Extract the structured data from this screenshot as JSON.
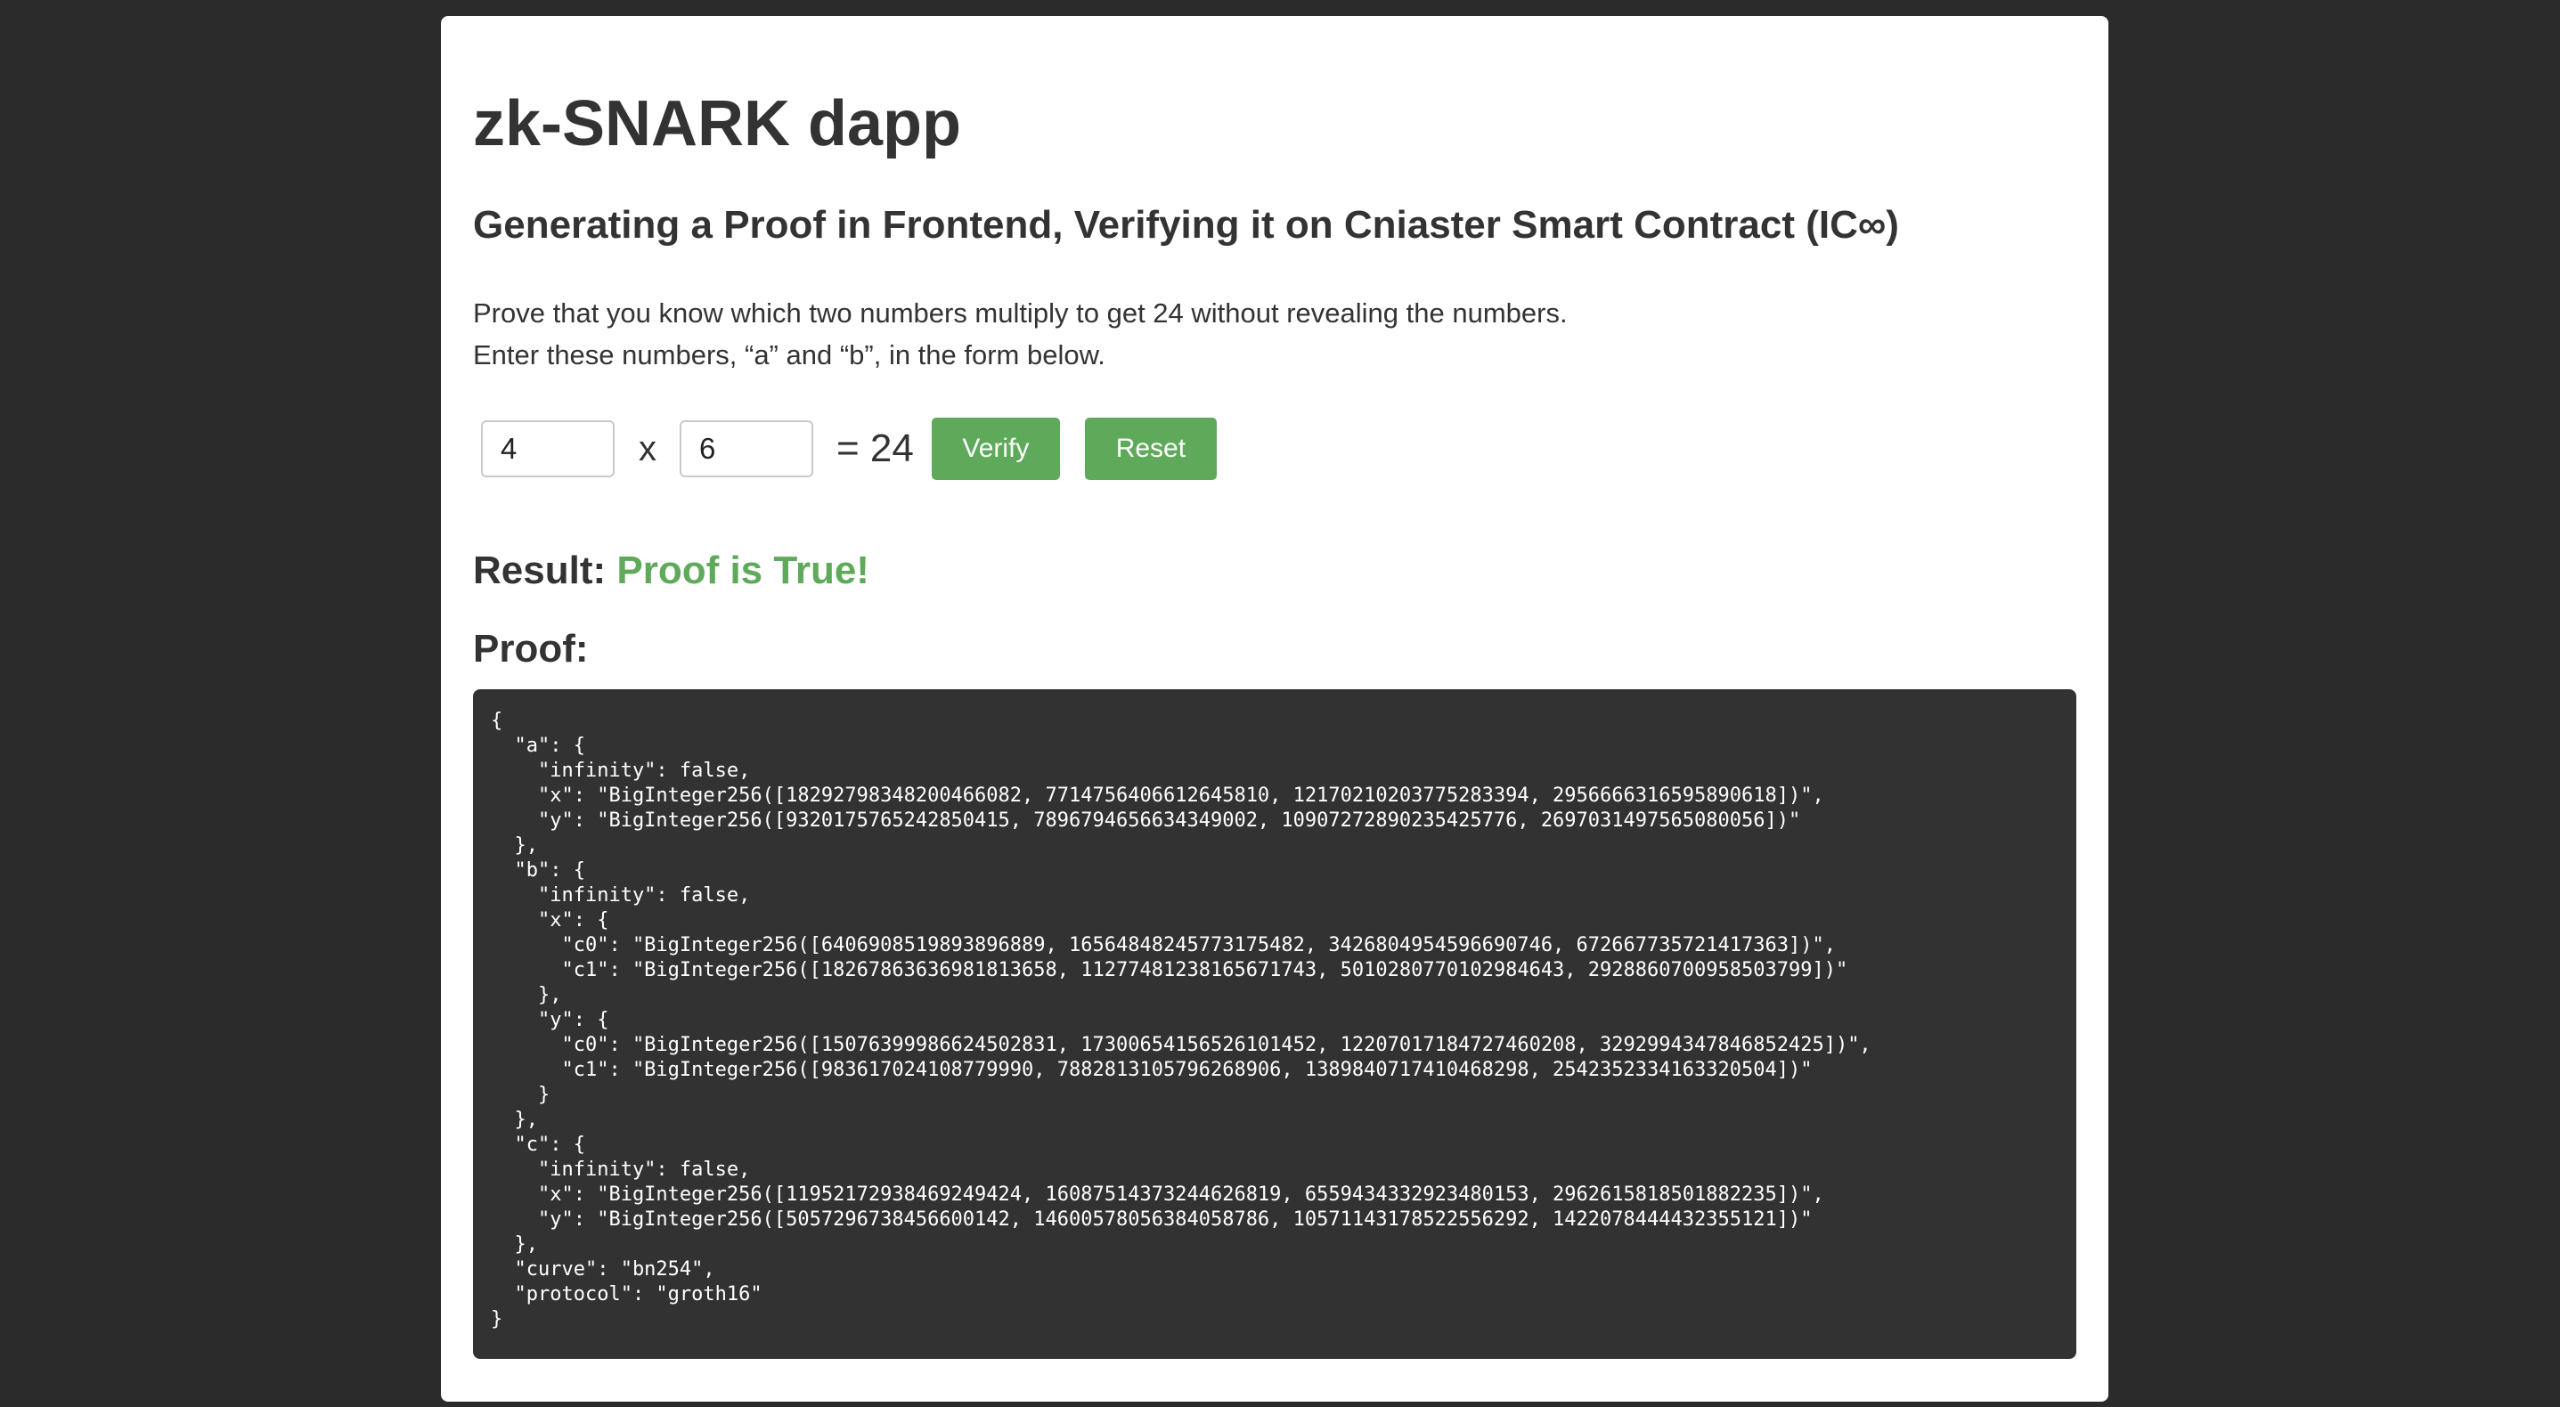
{
  "page": {
    "title": "zk-SNARK dapp",
    "subtitle": "Generating a Proof in Frontend, Verifying it on Cniaster Smart Contract (IC∞)",
    "description_line1": "Prove that you know which two numbers multiply to get 24 without revealing the numbers.",
    "description_line2": "Enter these numbers, “a” and “b”, in the form below."
  },
  "form": {
    "a_value": "4",
    "times_symbol": "x",
    "b_value": "6",
    "equals_text": "= 24",
    "verify_label": "Verify",
    "reset_label": "Reset"
  },
  "result": {
    "label": "Result:",
    "value": "Proof is True!",
    "value_color": "#5faa5a"
  },
  "proof": {
    "label": "Proof:",
    "json_text": "{\n  \"a\": {\n    \"infinity\": false,\n    \"x\": \"BigInteger256([18292798348200466082, 7714756406612645810, 12170210203775283394, 2956666316595890618])\",\n    \"y\": \"BigInteger256([9320175765242850415, 7896794656634349002, 10907272890235425776, 2697031497565080056])\"\n  },\n  \"b\": {\n    \"infinity\": false,\n    \"x\": {\n      \"c0\": \"BigInteger256([6406908519893896889, 16564848245773175482, 3426804954596690746, 672667735721417363])\",\n      \"c1\": \"BigInteger256([18267863636981813658, 11277481238165671743, 5010280770102984643, 2928860700958503799])\"\n    },\n    \"y\": {\n      \"c0\": \"BigInteger256([15076399986624502831, 17300654156526101452, 12207017184727460208, 3292994347846852425])\",\n      \"c1\": \"BigInteger256([983617024108779990, 7882813105796268906, 1389840717410468298, 2542352334163320504])\"\n    }\n  },\n  \"c\": {\n    \"infinity\": false,\n    \"x\": \"BigInteger256([11952172938469249424, 16087514373244626819, 6559434332923480153, 2962615818501882235])\",\n    \"y\": \"BigInteger256([5057296738456600142, 14600578056384058786, 10571143178522556292, 1422078444432355121])\"\n  },\n  \"curve\": \"bn254\",\n  \"protocol\": \"groth16\"\n}"
  },
  "colors": {
    "page_background": "#2b2b2b",
    "card_background": "#ffffff",
    "button_green": "#5faa5a",
    "proof_background": "#323232"
  }
}
